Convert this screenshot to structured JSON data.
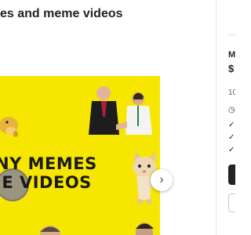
{
  "page": {
    "title": "es and meme videos"
  },
  "gallery": {
    "thumbnail_line1": "NY MEMES",
    "thumbnail_line2": "IE VIDEOS",
    "background_color": "#f7e600",
    "next_icon": "chevron-right-icon",
    "next_glyph": "›"
  },
  "sidebar": {
    "package_name": "M",
    "price": "$",
    "description": "10",
    "delivery_icon": "clock-icon",
    "delivery_glyph": "◷",
    "features": [
      "✓",
      "✓",
      "✓"
    ],
    "colors": {
      "cta": "#222325",
      "divider": "#e4e5e7"
    }
  }
}
